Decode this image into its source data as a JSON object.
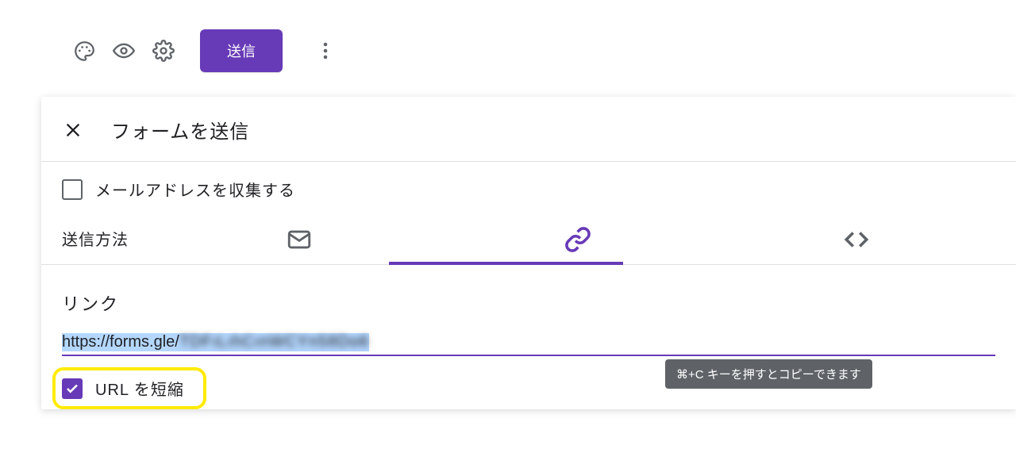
{
  "toolbar": {
    "send_label": "送信"
  },
  "dialog": {
    "title": "フォームを送信",
    "collect_email_label": "メールアドレスを収集する",
    "method_label": "送信方法",
    "section_title": "リンク",
    "url_prefix": "https://forms.gle/",
    "url_code_blurred": "TDFıLıhCınWCYn58Do6",
    "shorten_label": "URL を短縮",
    "tooltip": "⌘+C キーを押すとコピーできます"
  },
  "colors": {
    "accent": "#673ab7",
    "highlight": "#ffeb00"
  }
}
